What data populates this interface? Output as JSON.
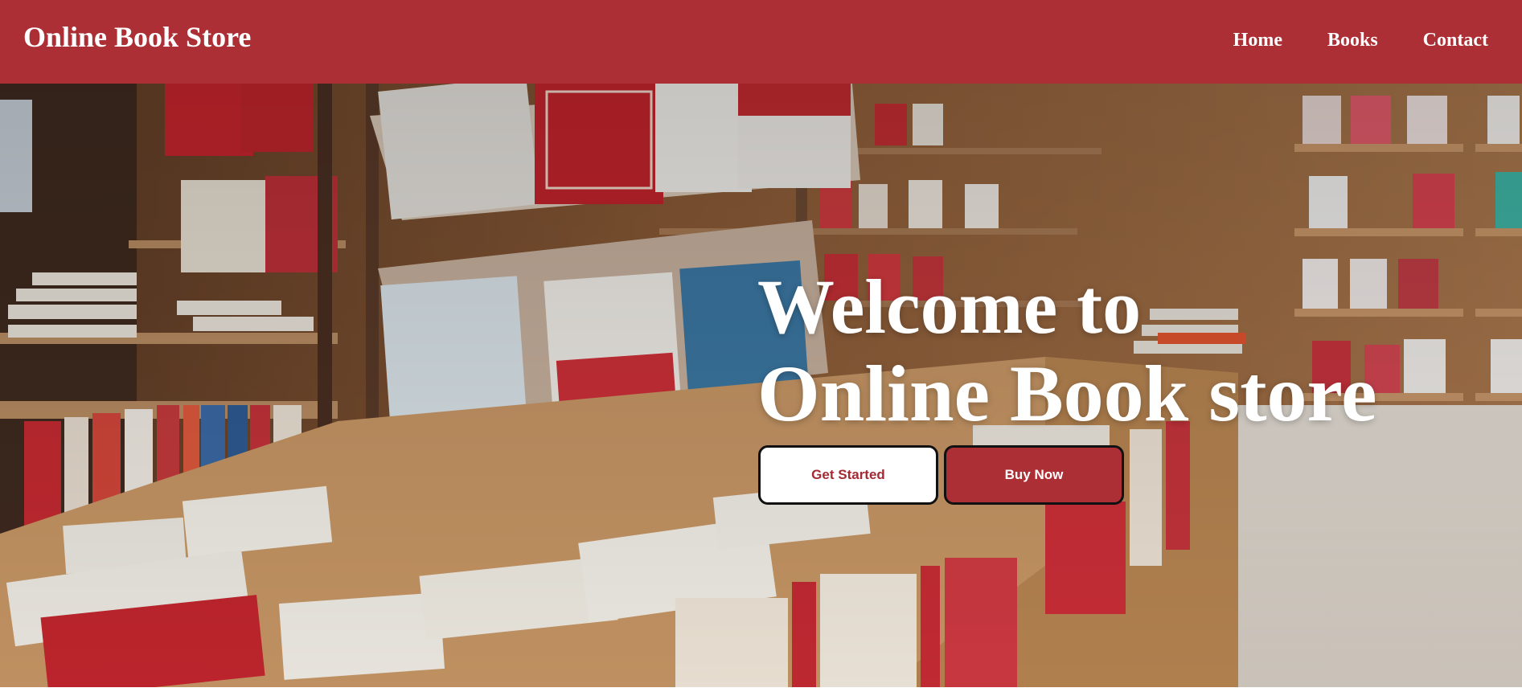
{
  "navbar": {
    "brand": "Online Book Store",
    "links": [
      "Home",
      "Books",
      "Contact"
    ]
  },
  "hero": {
    "title_line1": "Welcome to",
    "title_line2": "Online Book store",
    "primary_button": "Get Started",
    "secondary_button": "Buy Now"
  },
  "colors": {
    "brand_red": "#ad2f36",
    "button_white": "#ffffff"
  }
}
